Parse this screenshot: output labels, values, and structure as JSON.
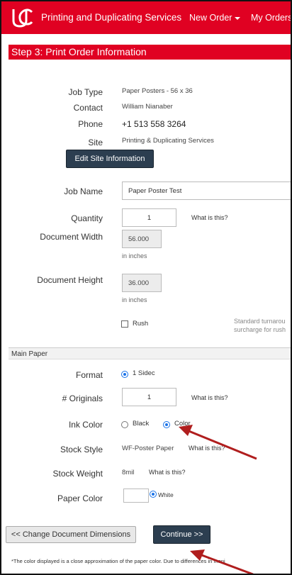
{
  "nav": {
    "brand": "Printing and Duplicating Services",
    "new_order": "New Order",
    "my_orders": "My Orders"
  },
  "step_title": "Step 3: Print Order Information",
  "info": {
    "job_type_label": "Job Type",
    "job_type_value": "Paper Posters - 56 x 36",
    "contact_label": "Contact",
    "contact_value": "William Nianaber",
    "phone_label": "Phone",
    "phone_value": "+1 513 558 3264",
    "site_label": "Site",
    "site_value": "Printing & Duplicating Services",
    "edit_site_button": "Edit Site Information"
  },
  "form": {
    "job_name_label": "Job Name",
    "job_name_value": "Paper Poster Test",
    "quantity_label": "Quantity",
    "quantity_value": "1",
    "quantity_help": "What is this?",
    "doc_width_label": "Document Width",
    "doc_width_value": "56.000",
    "doc_width_unit": "in inches",
    "doc_height_label": "Document Height",
    "doc_height_value": "36.000",
    "doc_height_unit": "in inches",
    "rush_label": "Rush",
    "rush_note_line1": "Standard turnarou",
    "rush_note_line2": "surcharge for rush"
  },
  "main_paper": {
    "section_title": "Main Paper",
    "format_label": "Format",
    "format_value": "1 Sidec",
    "originals_label": "# Originals",
    "originals_value": "1",
    "originals_help": "What is this?",
    "ink_label": "Ink Color",
    "ink_black": "Black",
    "ink_color": "Color",
    "stock_style_label": "Stock Style",
    "stock_style_value": "WF-Poster Paper",
    "stock_style_help": "What is this?",
    "stock_weight_label": "Stock Weight",
    "stock_weight_value": "8mil",
    "stock_weight_help": "What is this?",
    "paper_color_label": "Paper Color",
    "paper_color_value": "White"
  },
  "actions": {
    "back_button": "<< Change Document Dimensions",
    "continue_button": "Continue >>"
  },
  "footnote": "*The color displayed is a close approximation of the paper color. Due to differences in moni",
  "colors": {
    "brand_red": "#e00122",
    "button_dark": "#2c3e50",
    "radio_blue": "#1a73e8",
    "annotation_arrow": "#b01e1e"
  }
}
